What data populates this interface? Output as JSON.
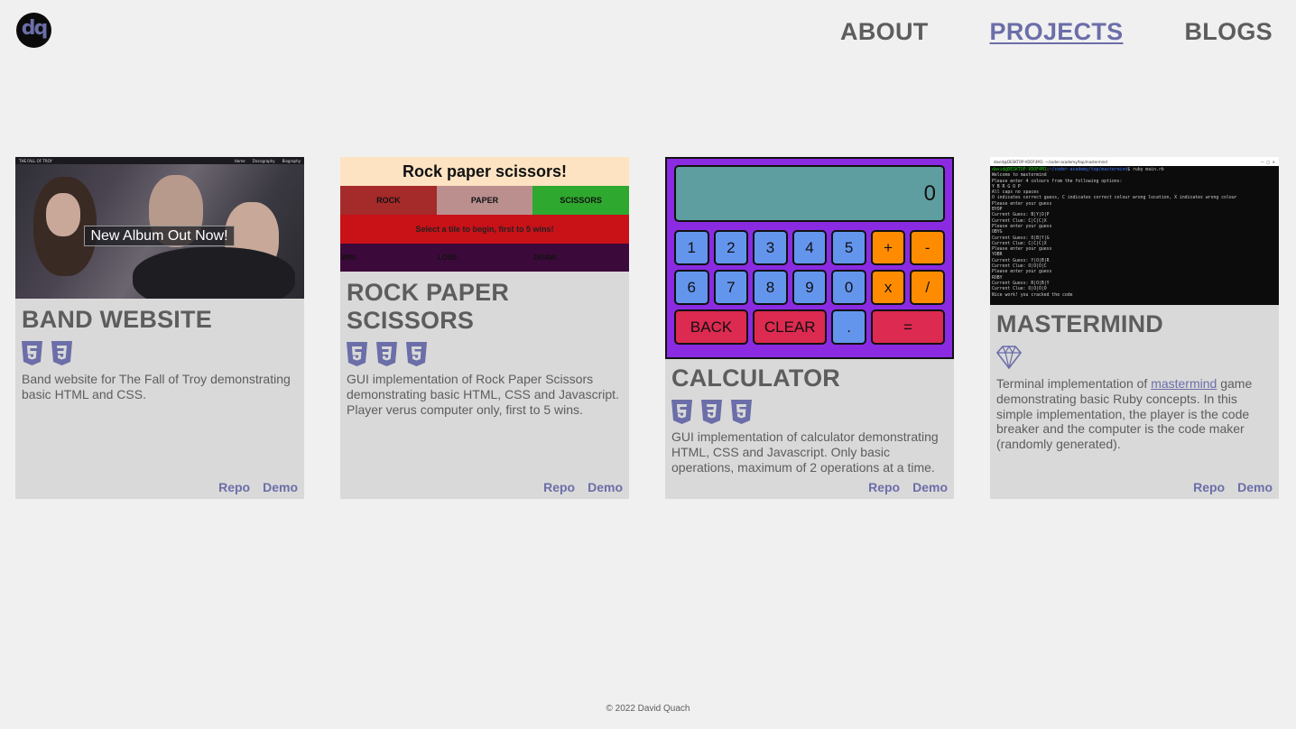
{
  "logo": {
    "text": "dq"
  },
  "nav": {
    "items": [
      "ABOUT",
      "PROJECTS",
      "BLOGS"
    ],
    "active": "PROJECTS"
  },
  "colors": {
    "accent": "#6b6ea8",
    "background": "#f0f0f0",
    "card": "#d9d9d9",
    "text": "#5d5d5d"
  },
  "cards": [
    {
      "title": "BAND WEBSITE",
      "icons": [
        "html5-icon",
        "css3-icon"
      ],
      "description": "Band website for The Fall of Troy demonstrating basic HTML and CSS.",
      "repo": "Repo",
      "demo": "Demo",
      "thumb": {
        "site_title": "THE FALL OF TROY",
        "nav": [
          "Home",
          "Discography",
          "Biography"
        ],
        "banner": "New Album Out Now!"
      }
    },
    {
      "title": "ROCK PAPER SCISSORS",
      "icons": [
        "html5-icon",
        "css3-icon",
        "javascript-icon"
      ],
      "description": "GUI implementation of Rock Paper Scissors demonstrating basic HTML, CSS and Javascript. Player verus computer only, first to 5 wins.",
      "repo": "Repo",
      "demo": "Demo",
      "thumb": {
        "title": "Rock paper scissors!",
        "choices": [
          "ROCK",
          "PAPER",
          "SCISSORS"
        ],
        "message": "Select a tile to begin, first to 5 wins!",
        "scores": [
          "WIN:",
          "LOSE:",
          "DRAW:"
        ]
      }
    },
    {
      "title": "CALCULATOR",
      "icons": [
        "html5-icon",
        "css3-icon",
        "javascript-icon"
      ],
      "description": "GUI implementation of calculator demonstrating HTML, CSS and Javascript. Only basic operations, maximum of 2 operations at a time.",
      "repo": "Repo",
      "demo": "Demo",
      "thumb": {
        "display": "0",
        "row1": [
          "1",
          "2",
          "3",
          "4",
          "5",
          "+",
          "-"
        ],
        "row2": [
          "6",
          "7",
          "8",
          "9",
          "0",
          "x",
          "/"
        ],
        "back": "BACK",
        "clear": "CLEAR",
        "dot": ".",
        "equals": "="
      }
    },
    {
      "title": "MASTERMIND",
      "icons": [
        "ruby-icon"
      ],
      "description_before": "Terminal implementation of ",
      "description_link": "mastermind",
      "description_after": " game demonstrating basic Ruby concepts. In this simple implementation, the player is the code breaker and the computer is the code maker (randomly generated).",
      "repo": "Repo",
      "demo": "Demo",
      "thumb": {
        "window_title": "david@DESKTOP-VDOF4M1: ~/coder-academy/top/mastermind",
        "prompt_user": "david@DESKTOP-VDOF4M1",
        "prompt_path": "~/coder-academy/top/mastermind",
        "command": "$ ruby main.rb",
        "lines": [
          "Welcome to mastermind",
          "Please enter 4 colours from the following options:",
          "Y B R G O P",
          "All caps no spaces",
          "O indicates correct guess, C indicates correct colour wrong location, X indicates wrong colour",
          "Please enter your guess",
          "BYOP",
          "Current Guess: B|Y|O|P",
          "Current Clue: C|C|C|X",
          "Please enter your guess",
          "OBYG",
          "Current Guess: O|B|Y|G",
          "Current Clue: C|C|C|X",
          "Please enter your guess",
          "YOBR",
          "Current Guess: Y|O|B|R",
          "Current Clue: O|O|O|C",
          "Please enter your guess",
          "ROBY",
          "Current Guess: R|O|B|Y",
          "Current Clue: O|O|O|O",
          "Nice work! you cracked the code"
        ]
      }
    }
  ],
  "footer": "© 2022 David Quach"
}
